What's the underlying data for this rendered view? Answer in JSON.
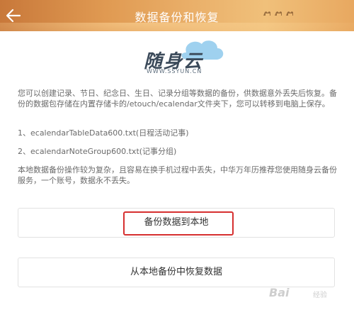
{
  "header": {
    "title": "数据备份和恢复",
    "back_icon": "back-arrow-icon"
  },
  "logo": {
    "text": "随身云",
    "url": "WWW.SSYUN.CN"
  },
  "description": {
    "main": "您可以创建记录、节日、纪念日、生日、记录分组等数据的备份，供数据意外丢失后恢复。备份的数据包存储在内置存储卡的/etouch/ecalendar文件夹下，您可以转移到电脑上保存。",
    "file1": "1、ecalendarTableData600.txt(日程活动记事)",
    "file2": "2、ecalendarNoteGroup600.txt(记事分组)",
    "note": "本地数据备份操作较为复杂，且容易在换手机过程中丢失，中华万年历推荐您使用随身云备份服务，一个账号，数据永不丢失。"
  },
  "buttons": {
    "backup_label": "备份数据到本地",
    "restore_label": "从本地备份中恢复数据"
  },
  "watermark": {
    "text": "Bai",
    "sub": "经验"
  },
  "colors": {
    "header_gradient_start": "#c8783a",
    "header_gradient_end": "#f0c07a",
    "highlight": "#d63030",
    "button_border": "#e2e2e2"
  }
}
